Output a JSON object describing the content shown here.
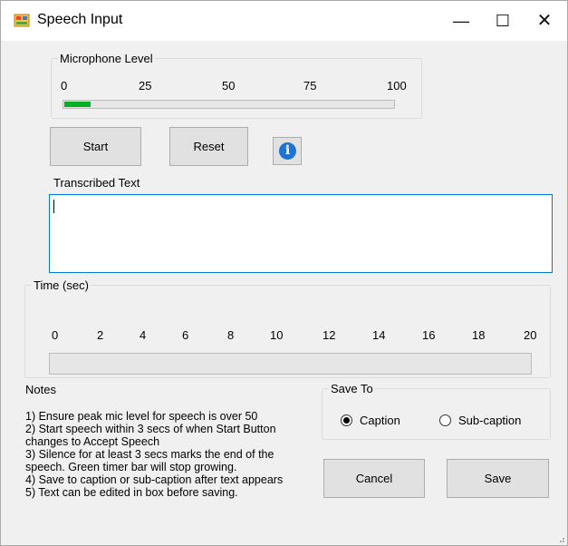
{
  "window": {
    "title": "Speech Input",
    "minimize_glyph": "—",
    "maximize_glyph": "☐",
    "close_glyph": "✕"
  },
  "mic": {
    "legend": "Microphone Level",
    "ticks": [
      "0",
      "25",
      "50",
      "75",
      "100"
    ],
    "level_percent": 8
  },
  "controls": {
    "start_label": "Start",
    "reset_label": "Reset",
    "info_glyph": "i"
  },
  "transcribed": {
    "label": "Transcribed Text",
    "value": ""
  },
  "time": {
    "legend": "Time (sec)",
    "ticks": [
      "0",
      "2",
      "4",
      "6",
      "8",
      "10",
      "12",
      "14",
      "16",
      "18",
      "20"
    ],
    "progress_percent": 0
  },
  "notes": {
    "title": "Notes",
    "lines": [
      "1) Ensure peak mic level for speech is over 50",
      "2) Start speech within 3 secs of when Start Button",
      "changes to Accept Speech",
      "3) Silence for at least 3 secs marks the end of the",
      "speech.  Green timer bar will stop growing.",
      "4) Save to caption or sub-caption after text appears",
      "5) Text can be edited in box before saving."
    ]
  },
  "save_to": {
    "legend": "Save To",
    "options": [
      "Caption",
      "Sub-caption"
    ],
    "selected": "Caption"
  },
  "actions": {
    "cancel_label": "Cancel",
    "save_label": "Save"
  },
  "colors": {
    "progress_green": "#06b025",
    "focus_blue": "#0078d7",
    "info_blue": "#1e74d0"
  }
}
